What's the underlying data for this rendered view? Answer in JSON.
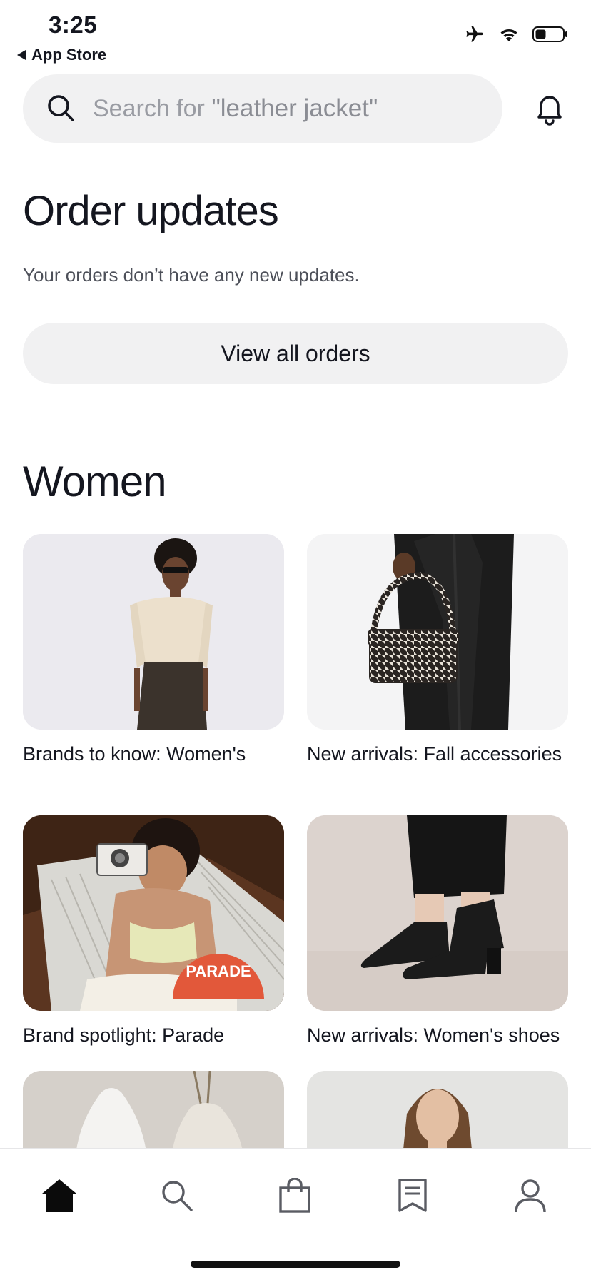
{
  "status_bar": {
    "time": "3:25",
    "back_label": "App Store"
  },
  "search": {
    "prefix": "Search for ",
    "query": "\"leather jacket\""
  },
  "order_updates": {
    "title": "Order updates",
    "message": "Your orders don’t have any new updates.",
    "button_label": "View all orders"
  },
  "women": {
    "title": "Women",
    "cards": [
      {
        "caption": "Brands to know: Women's"
      },
      {
        "caption": "New arrivals: Fall accessories"
      },
      {
        "caption": "Brand spotlight: Parade",
        "badge": "PARADE"
      },
      {
        "caption": "New arrivals: Women's shoes"
      },
      {
        "caption": ""
      },
      {
        "caption": ""
      }
    ]
  },
  "tab_bar": {
    "items": [
      {
        "icon": "home-icon",
        "active": true
      },
      {
        "icon": "search-icon",
        "active": false
      },
      {
        "icon": "bag-icon",
        "active": false
      },
      {
        "icon": "receipt-icon",
        "active": false
      },
      {
        "icon": "profile-icon",
        "active": false
      }
    ]
  },
  "colors": {
    "text": "#14161f",
    "muted": "#4d5059",
    "pill_bg": "#f1f1f2",
    "parade_orange": "#e2583a"
  }
}
